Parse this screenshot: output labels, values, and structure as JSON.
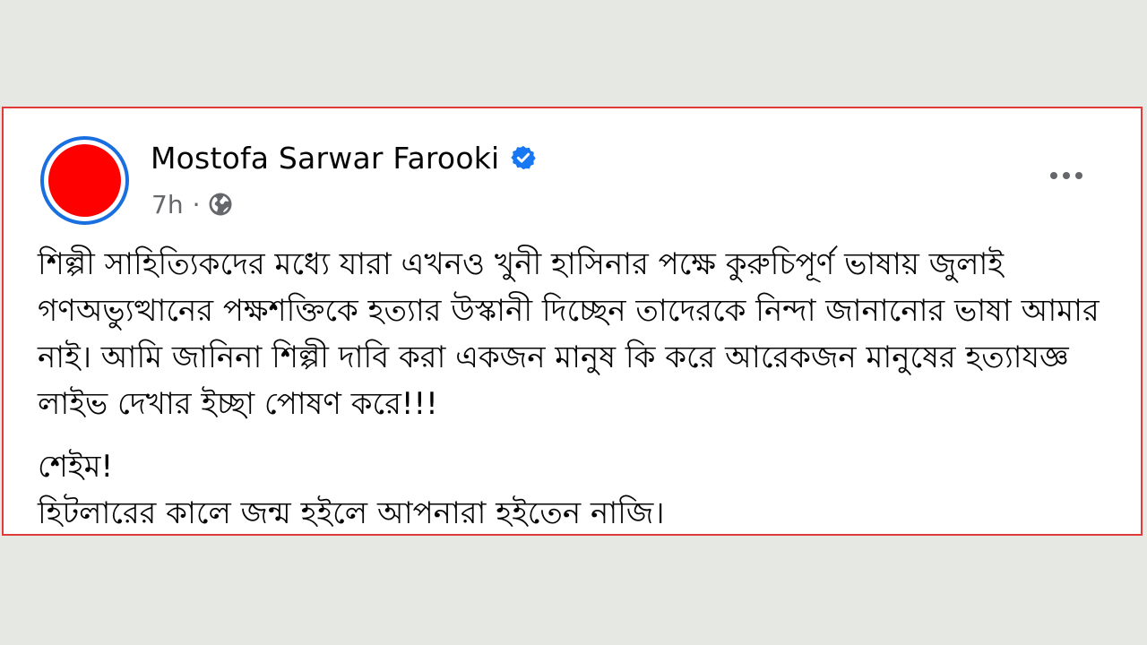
{
  "post": {
    "author_name": "Mostofa Sarwar Farooki",
    "timestamp": "7h",
    "separator": "·",
    "privacy_icon": "globe-icon",
    "verified_icon": "verified-badge-icon",
    "more_icon": "more-options-icon",
    "paragraphs": [
      "শিল্পী সাহিত্যিকদের মধ্যে যারা এখনও খুনী হাসিনার পক্ষে কুরুচিপূর্ণ ভাষায় জুলাই গণঅভ্যুত্থানের পক্ষশক্তিকে হত্যার উস্কানী দিচ্ছেন তাদেরকে নিন্দা জানানোর ভাষা আমার নাই। আমি জানিনা শিল্পী দাবি করা একজন মানুষ কি করে আরেকজন মানুষের হত্যাযজ্ঞ লাইভ দেখার ইচ্ছা পোষণ করে!!!",
      "শেইম!\nহিটলারের কালে জন্ম হইলে আপনারা হইতেন নাজি।"
    ]
  },
  "colors": {
    "page_background": "#e6e9e3",
    "card_border": "#e03a3a",
    "avatar_fill": "#ff0000",
    "avatar_ring": "#1a6fe0",
    "verified_blue": "#1877f2",
    "meta_gray": "#65676b",
    "text": "#050505"
  }
}
